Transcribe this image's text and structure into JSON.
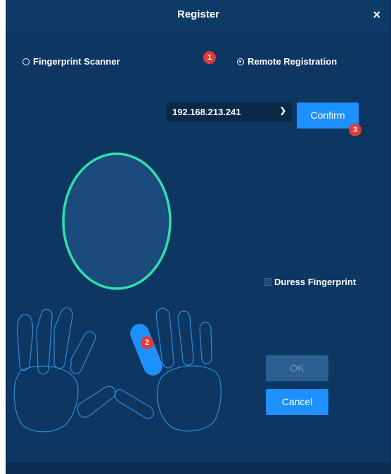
{
  "dialog": {
    "title": "Register",
    "close_glyph": "×"
  },
  "registration_mode": {
    "options": [
      {
        "label": "Fingerprint Scanner",
        "selected": false
      },
      {
        "label": "Remote Registration",
        "selected": true
      }
    ]
  },
  "device": {
    "selected_ip": "192.168.213.241",
    "confirm_label": "Confirm"
  },
  "badges": [
    "1",
    "2",
    "3"
  ],
  "duress": {
    "label": "Duress Fingerprint",
    "checked": false
  },
  "actions": {
    "ok_label": "OK",
    "cancel_label": "Cancel"
  },
  "colors": {
    "accent": "#1e90ff",
    "scan_ring": "#2fe0a8",
    "badge": "#e53935",
    "finger_outline": "#2f8bd8",
    "selected_finger": "#1e90ff"
  }
}
